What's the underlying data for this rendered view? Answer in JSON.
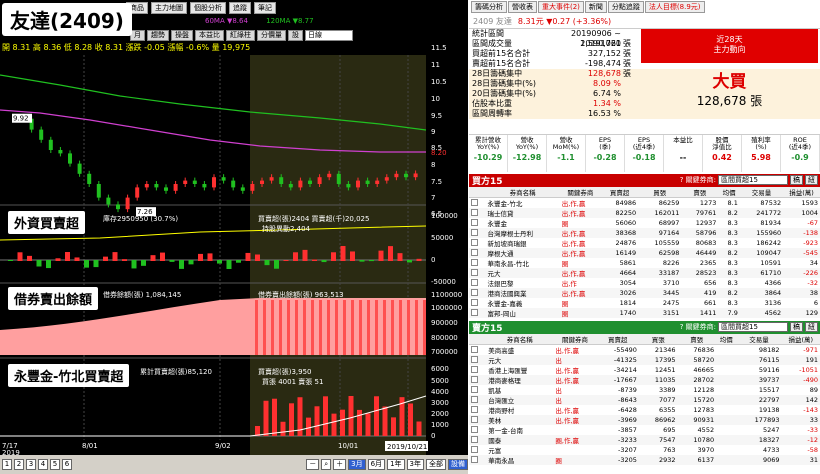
{
  "title": "友達(2409)",
  "menu": [
    "商品",
    "主力地圖",
    "個股分析",
    "追蹤",
    "筆記"
  ],
  "ma": {
    "ma60": "60MA ▼8.64",
    "ma120": "120MA ▼8.77"
  },
  "toolbar": [
    "月",
    "趨勢",
    "操盤",
    "本益比",
    "紅綠柱",
    "分價量",
    "設"
  ],
  "period": "日線",
  "ohlc": "開 8.31  高 8.36  低 8.28  收 8.31   漲跌 -0.05  漲幅 -0.6%  量 19,975",
  "y_price": [
    "11.5",
    "11",
    "10.5",
    "10",
    "9.5",
    "9",
    "8.5",
    "8.20",
    "8",
    "7.5",
    "7",
    "6.5"
  ],
  "price_marks": [
    "9.92",
    "7.26"
  ],
  "panels": [
    {
      "label": "外資買賣超",
      "info1": "庫存2950950 (30.7%)",
      "info2": "買賣超(張)2404 買賣超(千)20,025",
      "info3": "持股異動2,404",
      "y": [
        "100000",
        "50000",
        "0",
        "-50000"
      ]
    },
    {
      "label": "借券賣出餘額",
      "info1": "借券餘額(張) 1,084,145",
      "info2": "借券賣出餘額(張) 963,513",
      "y": [
        "1100000",
        "1000000",
        "900000",
        "800000",
        "700000"
      ]
    },
    {
      "label": "永豐金-竹北買賣超",
      "info1": "累計買賣超(張)85,120",
      "info2": "買賣超(張)3,950",
      "info3": "買張 4001 賣張 51",
      "y": [
        "6000",
        "5000",
        "4000",
        "3000",
        "2000",
        "1000",
        "0"
      ]
    }
  ],
  "x_dates": [
    "7/17",
    "8/01",
    "9/02",
    "10/01",
    "2019/10/21"
  ],
  "x_year": "2019",
  "pages": [
    "1",
    "2",
    "3",
    "4",
    "5",
    "6"
  ],
  "zoom_buttons": [
    "3月",
    "6月",
    "1年",
    "3年",
    "全部",
    "設備"
  ],
  "right": {
    "tabs": [
      "籌碼分析",
      "營收表",
      "重大事件(2)",
      "新聞",
      "分點追蹤",
      "法人目標(8.9元)"
    ],
    "stock_name": "2409 友達",
    "stock_price": "8.31元 ▼0.27 (+3.36%)",
    "summary": [
      {
        "k": "統計區間",
        "v": "20190906 ~ 20191021",
        "u": ""
      },
      {
        "k": "區間成交量",
        "v": "1,590,760",
        "u": "張"
      },
      {
        "k": "買超前15名合計",
        "v": "327,152",
        "u": "張"
      },
      {
        "k": "賣超前15名合計",
        "v": "-198,474",
        "u": "張"
      },
      {
        "k": "28日籌碼集中",
        "v": "128,678",
        "u": "張"
      },
      {
        "k": "28日籌碼集中(%)",
        "v": "8.09 %",
        "u": ""
      },
      {
        "k": "20日籌碼集中(%)",
        "v": "6.74 %",
        "u": ""
      },
      {
        "k": "佔股本比重",
        "v": "1.34 %",
        "u": ""
      },
      {
        "k": "區間周轉率",
        "v": "16.53 %",
        "u": ""
      }
    ],
    "redbox": [
      "近28天",
      "主力動向"
    ],
    "big_label": "大買",
    "big_value": "128,678 張",
    "stats_head": [
      "累計營收\nYoY(%)",
      "營收\nYoY(%)",
      "營收\nMoM(%)",
      "EPS\n(季)",
      "EPS\n(近4季)",
      "本益比",
      "股價\n淨值比",
      "殖利率\n(%)",
      "ROE\n(近4季)"
    ],
    "stats_val": [
      "-10.29",
      "-12.98",
      "-1.1",
      "-0.28",
      "-0.18",
      "--",
      "0.42",
      "5.98",
      "-0.9"
    ],
    "buy_title": "買方15",
    "sell_title": "賣方15",
    "filter_label": "? 關鍵券商:",
    "filter_value": "區間買超15",
    "btn_export": "稿",
    "btn_set": "紐",
    "cols": [
      "券商名稱",
      "關鍵券商",
      "買賣超",
      "買張",
      "賣張",
      "均價",
      "交易量",
      "損益(萬)"
    ],
    "buy_rows": [
      [
        "永豐金-竹北",
        "出,作,贏",
        "84986",
        "86259",
        "1273",
        "8.1",
        "87532",
        "1593"
      ],
      [
        "瑞士信貸",
        "出,作,贏",
        "82250",
        "162011",
        "79761",
        "8.2",
        "241772",
        "1004"
      ],
      [
        "永豐金",
        "圈",
        "56060",
        "68997",
        "12937",
        "8.3",
        "81934",
        "-67"
      ],
      [
        "台灣摩根士丹利",
        "出,作,贏",
        "38368",
        "97164",
        "58796",
        "8.3",
        "155960",
        "-138"
      ],
      [
        "新加坡商瑞銀",
        "出,作,贏",
        "24876",
        "105559",
        "80683",
        "8.3",
        "186242",
        "-923"
      ],
      [
        "摩根大通",
        "出,作,贏",
        "16149",
        "62598",
        "46449",
        "8.2",
        "109047",
        "-545"
      ],
      [
        "華南永昌-竹北",
        "圈",
        "5861",
        "8226",
        "2365",
        "8.3",
        "10591",
        "34"
      ],
      [
        "元大",
        "出,作,贏",
        "4664",
        "33187",
        "28523",
        "8.3",
        "61710",
        "-226"
      ],
      [
        "法銀巴黎",
        "出,作",
        "3054",
        "3710",
        "656",
        "8.3",
        "4366",
        "-32"
      ],
      [
        "港商法國興業",
        "出,作,贏",
        "3026",
        "3445",
        "419",
        "8.2",
        "3864",
        "38"
      ],
      [
        "永豐金-嘉義",
        "圈",
        "1814",
        "2475",
        "661",
        "8.3",
        "3136",
        "6"
      ],
      [
        "富邦-岡山",
        "圈",
        "1740",
        "3151",
        "1411",
        "7.9",
        "4562",
        "129"
      ]
    ],
    "sell_rows": [
      [
        "美商高盛",
        "出,作,贏",
        "-55490",
        "21346",
        "76836",
        "",
        "98182",
        "-971"
      ],
      [
        "元大",
        "出",
        "-41325",
        "17395",
        "58720",
        "",
        "76115",
        "191"
      ],
      [
        "香港上海匯豐",
        "出,作,贏",
        "-34214",
        "12451",
        "46665",
        "",
        "59116",
        "-1051"
      ],
      [
        "港商麥格理",
        "出,作,贏",
        "-17667",
        "11035",
        "28702",
        "",
        "39737",
        "-490"
      ],
      [
        "凱基",
        "出",
        "-8739",
        "3389",
        "12128",
        "",
        "15517",
        "89"
      ],
      [
        "台灣匯立",
        "出",
        "-8643",
        "7077",
        "15720",
        "",
        "22797",
        "142"
      ],
      [
        "港商野村",
        "出,作,贏",
        "-6428",
        "6355",
        "12783",
        "",
        "19138",
        "-143"
      ],
      [
        "美林",
        "出,作,贏",
        "-3969",
        "86962",
        "90931",
        "",
        "177893",
        "33"
      ],
      [
        "第一金-台南",
        "",
        "-3857",
        "695",
        "4552",
        "",
        "5247",
        "-33"
      ],
      [
        "國泰",
        "圈,作,贏",
        "-3233",
        "7547",
        "10780",
        "",
        "18327",
        "-12"
      ],
      [
        "元富",
        "",
        "-3207",
        "763",
        "3970",
        "",
        "4733",
        "-58"
      ],
      [
        "華南永昌",
        "圈",
        "-3205",
        "2932",
        "6137",
        "",
        "9069",
        "31"
      ]
    ]
  },
  "colors": {
    "red": "#e00000",
    "green": "#1f8f2f",
    "up": "#ff3030",
    "down": "#20c020"
  }
}
